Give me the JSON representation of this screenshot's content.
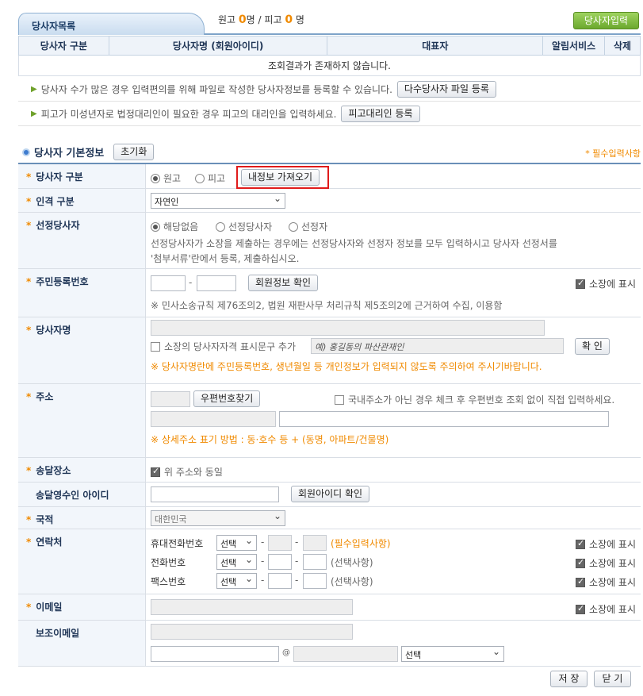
{
  "list": {
    "tab_label": "당사자목록",
    "counts": {
      "plaintiff_label": "원고",
      "plaintiff_count": "0",
      "plaintiff_unit": "명 /",
      "defendant_label": "피고",
      "defendant_count": "0",
      "defendant_unit": "명"
    },
    "add_button": "당사자입력",
    "columns": [
      "당사자 구분",
      "당사자명 (회원아이디)",
      "대표자",
      "알림서비스",
      "삭제"
    ],
    "empty_message": "조회결과가 존재하지 않습니다."
  },
  "notices": [
    {
      "text": "당사자 수가 많은 경우 입력편의를 위해 파일로 작성한 당사자정보를 등록할 수 있습니다.",
      "button": "다수당사자 파일 등록"
    },
    {
      "text": "피고가 미성년자로 법정대리인이 필요한 경우 피고의 대리인을 입력하세요.",
      "button": "피고대리인 등록"
    }
  ],
  "section": {
    "title": "당사자 기본정보",
    "reset_button": "초기화",
    "required_note": "* 필수입력사항"
  },
  "form": {
    "party_type": {
      "label": "당사자 구분",
      "options": [
        "원고",
        "피고"
      ],
      "selected": "원고",
      "fetch_button": "내정보 가져오기"
    },
    "person_type": {
      "label": "인격 구분",
      "value": "자연인"
    },
    "selected_party": {
      "label": "선정당사자",
      "options": [
        "해당없음",
        "선정당사자",
        "선정자"
      ],
      "selected": "해당없음",
      "desc1": "선정당사자가 소장을 제출하는 경우에는 선정당사자와 선정자 정보를 모두 입력하시고 당사자 선정서를",
      "desc2": "'첨부서류'란에서 등록, 제출하십시오."
    },
    "rrn": {
      "label": "주민등록번호",
      "dash": "-",
      "check_button": "회원정보 확인",
      "print_label": "소장에 표시",
      "note": "※ 민사소송규칙 제76조의2, 법원 재판사무 처리규칙 제5조의2에 근거하여 수집, 이용함"
    },
    "party_name": {
      "label": "당사자명",
      "check_label": "소장의 당사자자격 표시문구 추가",
      "placeholder": "예) 홍길동의 파산관재인",
      "confirm_button": "확 인",
      "warning": "※ 당사자명란에 주민등록번호, 생년월일 등 개인정보가 입력되지 않도록 주의하여 주시기바랍니다."
    },
    "address": {
      "label": "주소",
      "zip_button": "우편번호찾기",
      "foreign_check": "국내주소가 아닌 경우 체크 후 우편번호 조회 없이 직접 입력하세요.",
      "note": "※ 상세주소 표기 방법 : 동·호수 등 + (동명, 아파트/건물명)"
    },
    "delivery": {
      "label": "송달장소",
      "same_label": "위 주소와 동일"
    },
    "recipient_id": {
      "label": "송달영수인 아이디",
      "check_button": "회원아이디 확인"
    },
    "nationality": {
      "label": "국적",
      "value": "대한민국"
    },
    "contact": {
      "label": "연락처",
      "print_label": "소장에 표시",
      "rows": [
        {
          "name": "휴대전화번호",
          "select": "선택",
          "note": "(필수입력사항)"
        },
        {
          "name": "전화번호",
          "select": "선택",
          "note": "(선택사항)"
        },
        {
          "name": "팩스번호",
          "select": "선택",
          "note": "(선택사항)"
        }
      ]
    },
    "email": {
      "label": "이메일",
      "print_label": "소장에 표시"
    },
    "sub_email": {
      "label": "보조이메일",
      "at": "@",
      "select": "선택"
    }
  },
  "footer": {
    "save": "저 장",
    "close": "닫 기"
  }
}
